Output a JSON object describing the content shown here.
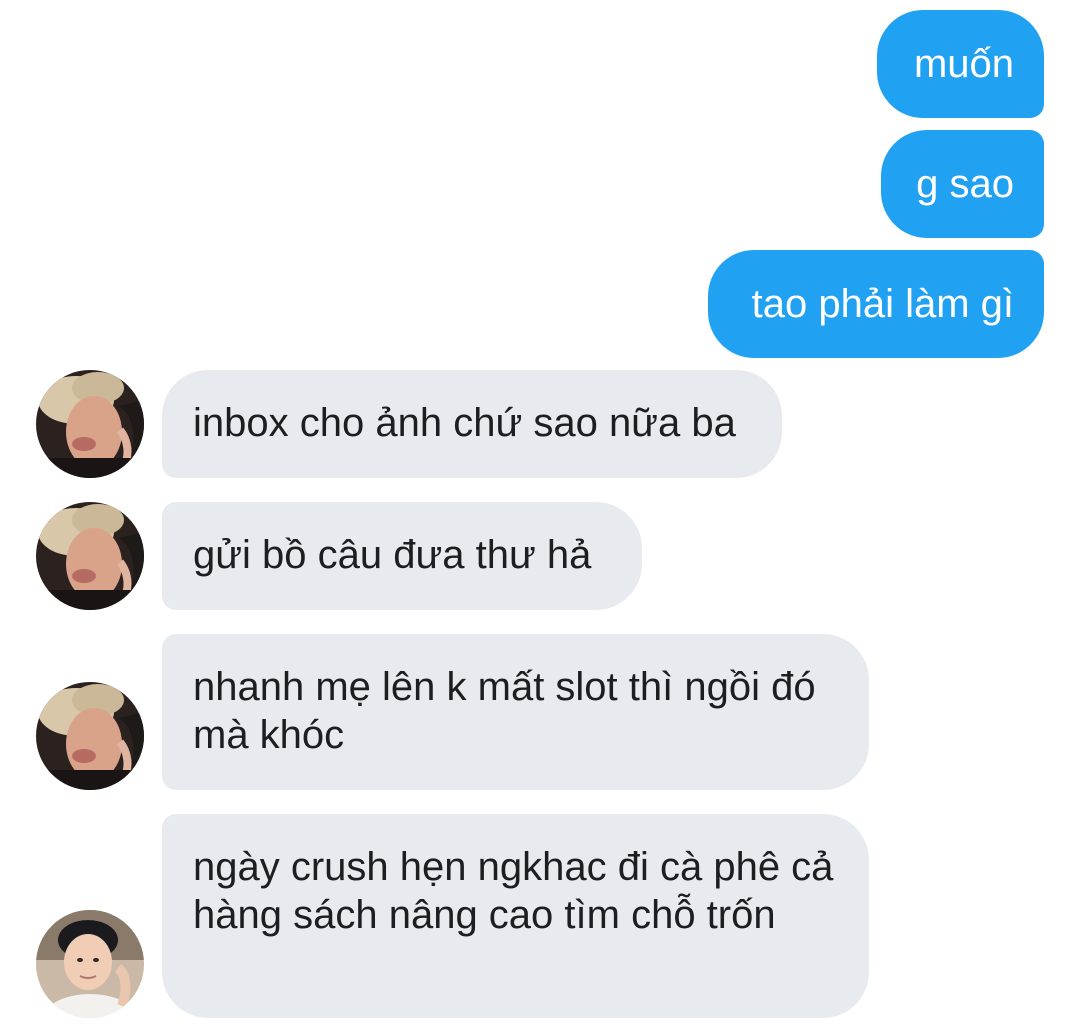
{
  "conversation": {
    "outgoing": [
      {
        "text": "muốn"
      },
      {
        "text": "g sao"
      },
      {
        "text": "tao phải làm gì"
      }
    ],
    "incoming": [
      {
        "text": "inbox cho ảnh chứ sao nữa ba",
        "avatar": "profile-photo-blond"
      },
      {
        "text": "gửi bồ câu đưa thư hả",
        "avatar": "profile-photo-blond"
      },
      {
        "text": "nhanh mẹ lên k mất slot thì ngồi đó mà khóc",
        "avatar": "profile-photo-blond"
      },
      {
        "text": "ngày crush hẹn ngkhac đi cà phê cả hàng sách nâng cao tìm chỗ trốn",
        "avatar": "profile-photo-darkhair"
      }
    ]
  },
  "colors": {
    "outgoing_bubble": "#21a1f1",
    "incoming_bubble": "#e7ebef",
    "incoming_text": "#1c1e21",
    "background": "#ffffff"
  }
}
